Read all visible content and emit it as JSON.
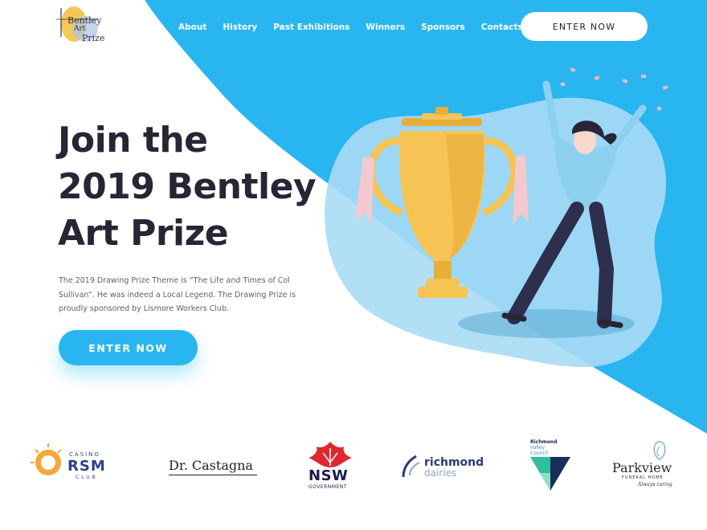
{
  "logo": {
    "line1": "Bentley",
    "line2": "Art",
    "line3": "Prize"
  },
  "nav": {
    "items": [
      {
        "label": "About"
      },
      {
        "label": "History"
      },
      {
        "label": "Past Exhibitions"
      },
      {
        "label": "Winners"
      },
      {
        "label": "Sponsors"
      },
      {
        "label": "Contacts"
      }
    ],
    "cta_label": "ENTER NOW"
  },
  "hero": {
    "title_lines": [
      "Join the",
      "2019 Bentley",
      "Art Prize"
    ],
    "description": "The 2019 Drawing Prize Theme is “The Life and Times of Col Sullivan”. He was indeed a Local Legend. The Drawing Prize is proudly sponsored by Lismore Workers Club.",
    "cta_label": "ENTER NOW"
  },
  "sponsors": {
    "rsm": {
      "top": "CASINO",
      "main": "RSM",
      "bottom": "CLUB"
    },
    "castagna": {
      "name": "Dr. Castagna"
    },
    "nsw": {
      "main": "NSW",
      "sub": "GOVERNMENT"
    },
    "richmond_dairies": {
      "line1": "richmond",
      "line2": "dairies"
    },
    "council": {
      "line1": "Richmond",
      "line2": "Valley",
      "line3": "Council"
    },
    "parkview": {
      "name": "Parkview",
      "sub": "FUNERAL HOME",
      "tagline": "Always caring"
    }
  },
  "colors": {
    "brand_blue": "#29b6f0",
    "light_blue": "#a8dcf5",
    "dark_text": "#262636",
    "trophy_gold": "#f6c454"
  }
}
